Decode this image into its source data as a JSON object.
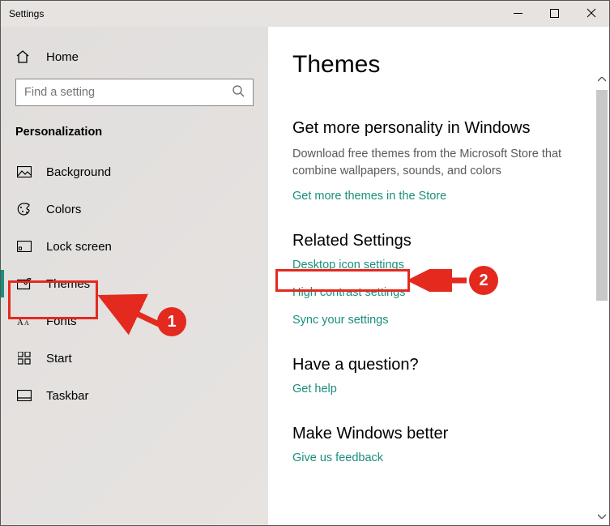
{
  "window": {
    "title": "Settings"
  },
  "sidebar": {
    "home": "Home",
    "search_placeholder": "Find a setting",
    "section_title": "Personalization",
    "items": [
      {
        "label": "Background",
        "icon": "picture"
      },
      {
        "label": "Colors",
        "icon": "palette"
      },
      {
        "label": "Lock screen",
        "icon": "lock-screen"
      },
      {
        "label": "Themes",
        "icon": "pen-screen",
        "active": true
      },
      {
        "label": "Fonts",
        "icon": "fonts"
      },
      {
        "label": "Start",
        "icon": "start-grid"
      },
      {
        "label": "Taskbar",
        "icon": "taskbar"
      }
    ]
  },
  "main": {
    "title": "Themes",
    "section_personality": {
      "heading": "Get more personality in Windows",
      "body": "Download free themes from the Microsoft Store that combine wallpapers, sounds, and colors",
      "link": "Get more themes in the Store"
    },
    "section_related": {
      "heading": "Related Settings",
      "links": {
        "desktop_icons": "Desktop icon settings",
        "high_contrast": "High contrast settings",
        "sync": "Sync your settings"
      }
    },
    "section_question": {
      "heading": "Have a question?",
      "link": "Get help"
    },
    "section_better": {
      "heading": "Make Windows better",
      "link": "Give us feedback"
    }
  },
  "annotations": {
    "step1": "1",
    "step2": "2"
  }
}
